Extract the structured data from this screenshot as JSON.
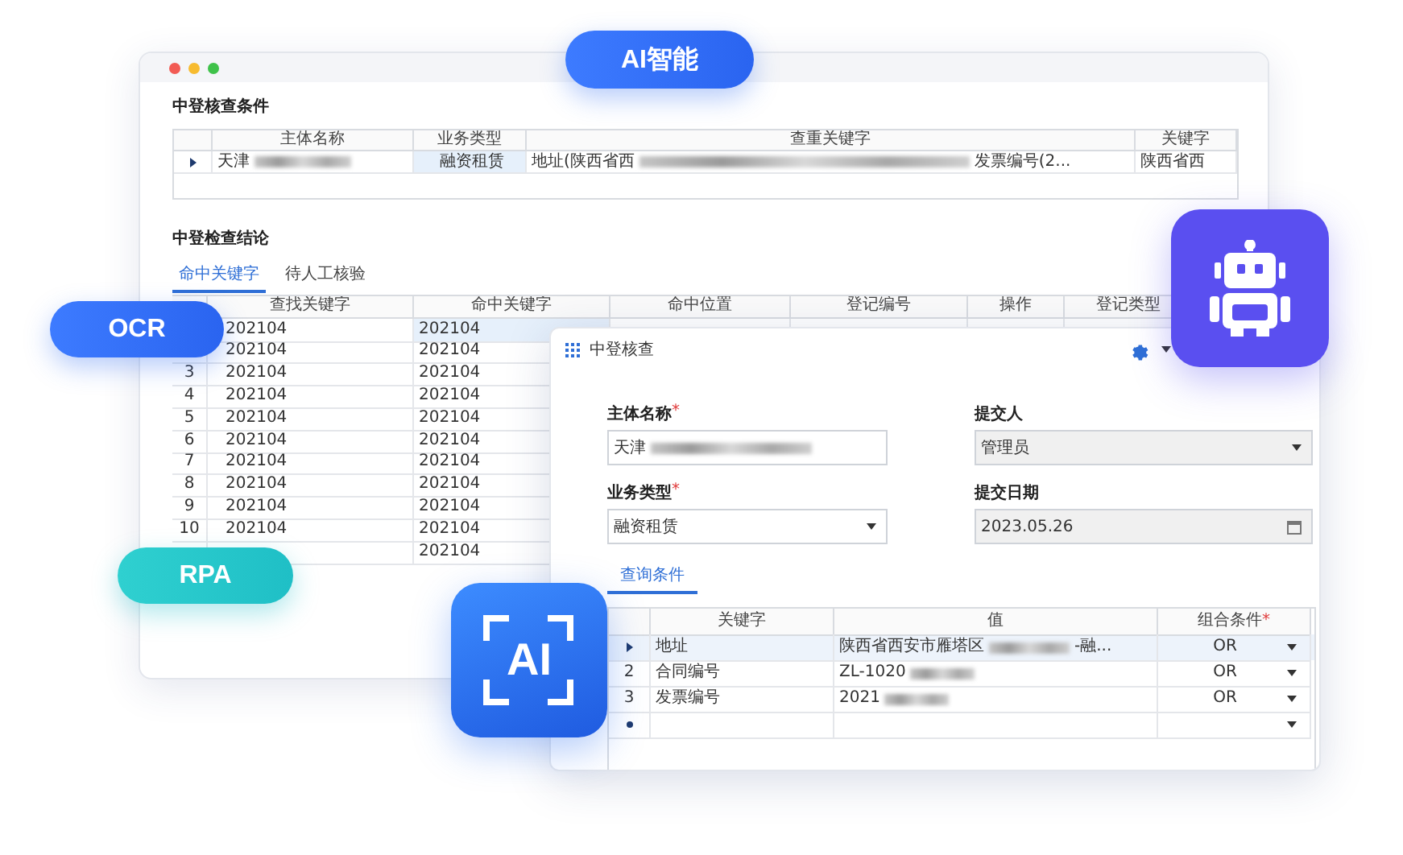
{
  "badges": [
    {
      "text": "AI智能",
      "kind": "blue"
    },
    {
      "text": "OCR",
      "kind": "blue"
    },
    {
      "text": "RPA",
      "kind": "teal"
    }
  ],
  "ai_tile": {
    "text": "AI"
  },
  "back_window": {
    "conditions_title": "中登核查条件",
    "conditions_table": {
      "columns": [
        "主体名称",
        "业务类型",
        "查重关键字",
        "关键字"
      ],
      "rows": [
        {
          "entity": "天津",
          "entity_redacted": true,
          "type": "融资租赁",
          "keywords_start": "地址(陕西省西",
          "keywords_end": "发票编号(2...",
          "keyword": "陕西省西",
          "selected": true
        }
      ]
    },
    "results_title": "中登检查结论",
    "tabs": [
      {
        "label": "命中关键字",
        "selected": true
      },
      {
        "label": "待人工核验",
        "selected": false
      }
    ],
    "results_table": {
      "columns": [
        "查找关键字",
        "命中关键字",
        "命中位置",
        "登记编号",
        "操作",
        "登记类型"
      ],
      "rows": [
        {
          "find": "202104",
          "hit": "202104",
          "selected": true
        },
        {
          "find": "202104",
          "hit": "202104",
          "selected": false
        },
        {
          "num": "3",
          "find": "202104",
          "hit": "202104",
          "selected": false
        },
        {
          "num": "4",
          "find": "202104",
          "hit": "202104",
          "selected": false
        },
        {
          "num": "5",
          "find": "202104",
          "hit": "202104",
          "selected": false
        },
        {
          "num": "6",
          "find": "202104",
          "hit": "202104",
          "selected": false
        },
        {
          "num": "7",
          "find": "202104",
          "hit": "202104",
          "selected": false
        },
        {
          "num": "8",
          "find": "202104",
          "hit": "202104",
          "selected": false
        },
        {
          "num": "9",
          "find": "202104",
          "hit": "202104",
          "selected": false
        },
        {
          "num": "10",
          "find": "202104",
          "hit": "202104",
          "selected": false
        },
        {
          "hit": "202104",
          "selected": false
        }
      ]
    }
  },
  "front_window": {
    "title": "中登核查",
    "fields": [
      {
        "label": "主体名称",
        "required_mark": "*",
        "kind": "text",
        "value": "天津",
        "redacted": true,
        "disabled": false
      },
      {
        "label": "提交人",
        "kind": "select",
        "value": "管理员",
        "disabled": true
      },
      {
        "label": "业务类型",
        "required_mark": "*",
        "kind": "select",
        "value": "融资租赁",
        "disabled": false
      },
      {
        "label": "提交日期",
        "kind": "date",
        "value": "2023.05.26",
        "disabled": true
      }
    ],
    "tabs": [
      {
        "label": "查询条件",
        "selected": true
      }
    ],
    "query_table": {
      "columns": [
        {
          "label": "关键字"
        },
        {
          "label": "值"
        },
        {
          "label": "组合条件",
          "required_mark": "*"
        }
      ],
      "rows": [
        {
          "kind": "current",
          "keyword": "地址",
          "value": "陕西省西安市雁塔区",
          "value_end": "-融...",
          "redacted": true,
          "combine": "OR"
        },
        {
          "kind": "normal",
          "num": "2",
          "keyword": "合同编号",
          "value": "ZL-1020",
          "redacted": true,
          "combine": "OR"
        },
        {
          "kind": "normal",
          "num": "3",
          "keyword": "发票编号",
          "value": "2021",
          "redacted": true,
          "combine": "OR"
        },
        {
          "kind": "new"
        }
      ]
    }
  }
}
